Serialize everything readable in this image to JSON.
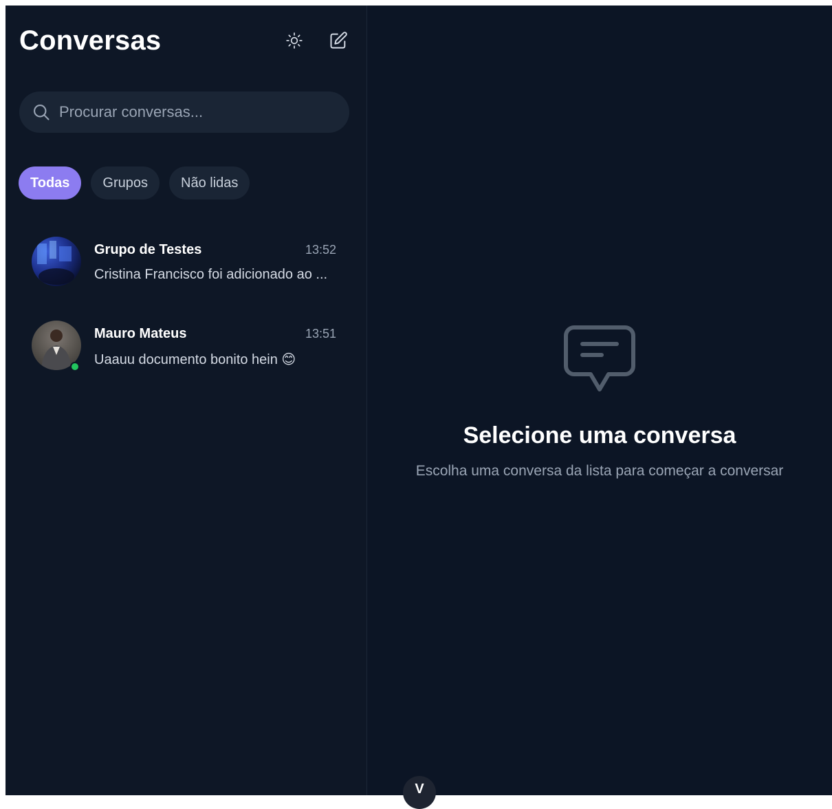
{
  "sidebar": {
    "title": "Conversas",
    "theme_icon": "sun-icon",
    "compose_icon": "edit-icon",
    "search": {
      "placeholder": "Procurar conversas...",
      "value": ""
    },
    "filters": [
      {
        "label": "Todas",
        "active": true
      },
      {
        "label": "Grupos",
        "active": false
      },
      {
        "label": "Não lidas",
        "active": false
      }
    ],
    "conversations": [
      {
        "name": "Grupo de Testes",
        "time": "13:52",
        "preview": "Cristina Francisco foi adicionado ao ...",
        "online": false
      },
      {
        "name": "Mauro Mateus",
        "time": "13:51",
        "preview": "Uaauu documento bonito hein 😊",
        "online": true
      }
    ]
  },
  "main": {
    "empty_icon": "chat-bubble-icon",
    "empty_title": "Selecione uma conversa",
    "empty_subtitle": "Escolha uma conversa da lista para começar a conversar"
  },
  "bottom_toggle": {
    "label": "V"
  },
  "colors": {
    "background": "#0d1626",
    "accent": "#8c7cf0",
    "online": "#22c55e"
  }
}
